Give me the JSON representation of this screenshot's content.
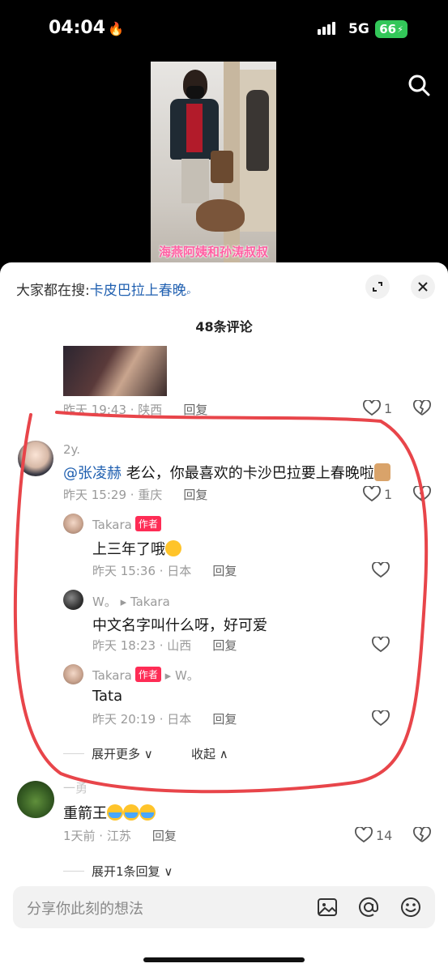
{
  "status_bar": {
    "time": "04:04",
    "network": "5G",
    "battery": "66"
  },
  "video": {
    "caption": "海燕阿姨和孙涛叔叔"
  },
  "panel": {
    "hot_search_prefix": "大家都在搜:",
    "hot_search_keyword": "卡皮巴拉上春晚",
    "comment_count": "48条评论"
  },
  "comments": {
    "c0": {
      "time": "昨天 19:43 · 陕西",
      "reply": "回复",
      "likes": "1"
    },
    "c1": {
      "user": "2y.",
      "mention": "@张凌赫",
      "text": " 老公，你最喜欢的卡沙巴拉要上春晚啦",
      "time": "昨天 15:29 · 重庆",
      "reply": "回复",
      "likes": "1",
      "replies": [
        {
          "user": "Takara",
          "tag": "作者",
          "text": "上三年了哦",
          "time": "昨天 15:36 · 日本",
          "reply": "回复"
        },
        {
          "user": "W。",
          "arrow": "▸",
          "to": "Takara",
          "text": "中文名字叫什么呀，好可爱",
          "time": "昨天 18:23 · 山西",
          "reply": "回复"
        },
        {
          "user": "Takara",
          "tag": "作者",
          "arrow": "▸",
          "to": "W。",
          "text": "Tata",
          "time": "昨天 20:19 · 日本",
          "reply": "回复"
        }
      ],
      "expand_more": "展开更多",
      "collapse": "收起"
    },
    "c2": {
      "user": "一勇",
      "text": "重箭王",
      "time": "1天前 · 江苏",
      "reply": "回复",
      "likes": "14",
      "expand_replies": "展开1条回复"
    }
  },
  "input": {
    "placeholder": "分享你此刻的想法"
  },
  "colors": {
    "accent_link": "#1f5fb0",
    "author_tag": "#fe2c55",
    "annotation": "#e8454a",
    "battery": "#33c759"
  },
  "icons": [
    "search-icon",
    "expand-icon",
    "close-icon",
    "heart-icon",
    "broken-heart-icon",
    "image-icon",
    "at-icon",
    "emoji-icon"
  ]
}
